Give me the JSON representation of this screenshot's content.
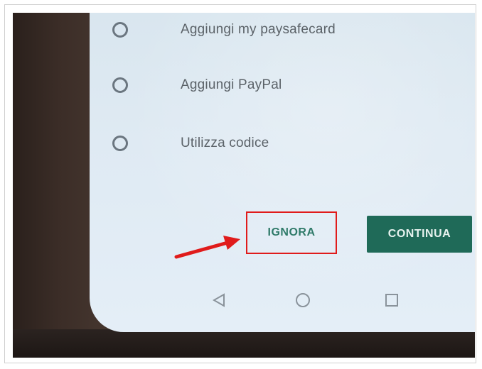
{
  "options": [
    {
      "label": "Aggiungi my paysafecard"
    },
    {
      "label": "Aggiungi PayPal"
    },
    {
      "label": "Utilizza codice"
    }
  ],
  "buttons": {
    "ignora": "IGNORA",
    "continua": "CONTINUA"
  },
  "nav": {
    "back_icon": "triangle-back-icon",
    "home_icon": "circle-home-icon",
    "recents_icon": "square-recents-icon"
  },
  "colors": {
    "highlight_box": "#e01b1b",
    "arrow": "#e01b1b",
    "continue_button": "#1f6a58",
    "ignore_text": "#2f7a69"
  }
}
